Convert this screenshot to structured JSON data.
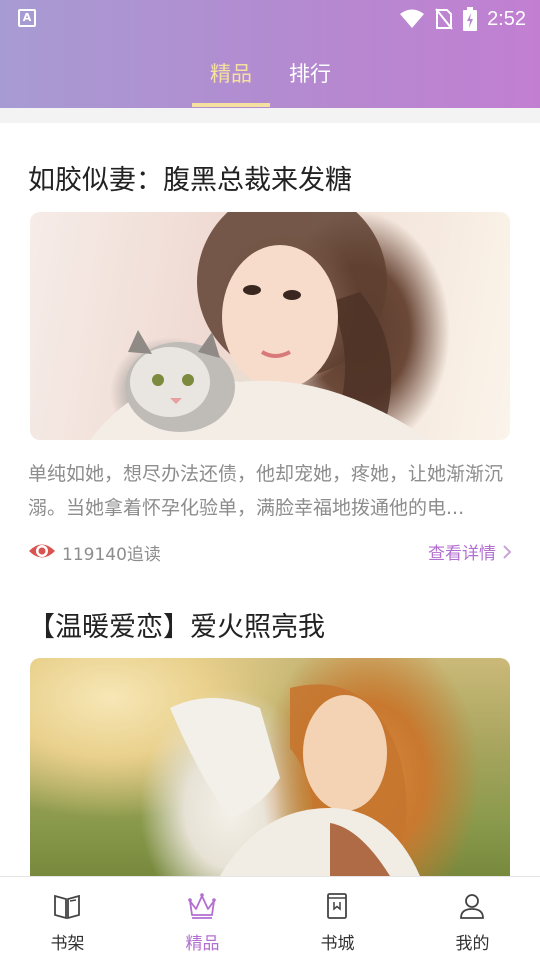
{
  "status_bar": {
    "time": "2:52",
    "app_icon_letter": "A"
  },
  "tabs": [
    {
      "label": "精品",
      "active": true
    },
    {
      "label": "排行",
      "active": false
    }
  ],
  "books": [
    {
      "title": "如胶似妻：腹黑总裁来发糖",
      "description": "单纯如她，想尽办法还债，他却宠她，疼她，让她渐渐沉溺。当她拿着怀孕化验单，满脸幸福地拨通他的电...",
      "reads": "119140追读",
      "detail_label": "查看详情"
    },
    {
      "title": "【温暖爱恋】爱火照亮我"
    }
  ],
  "bottom_nav": [
    {
      "label": "书架",
      "icon": "bookshelf-icon",
      "active": false
    },
    {
      "label": "精品",
      "icon": "crown-icon",
      "active": true
    },
    {
      "label": "书城",
      "icon": "bookstore-icon",
      "active": false
    },
    {
      "label": "我的",
      "icon": "profile-icon",
      "active": false
    }
  ],
  "colors": {
    "accent": "#b36fd0",
    "tab_active": "#f6e0a0",
    "header_start": "#a79bd3",
    "header_end": "#c27fd2",
    "eye_icon": "#d9534f"
  }
}
